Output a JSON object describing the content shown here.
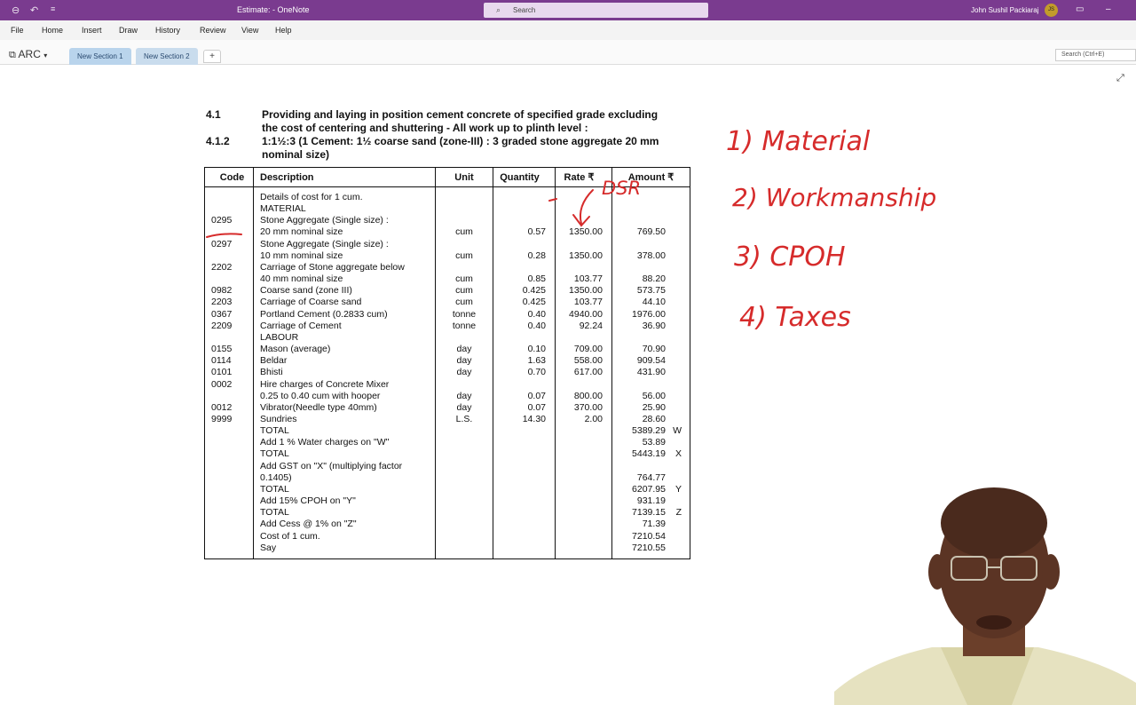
{
  "titlebar": {
    "doc_title": "Estimate:  -  OneNote",
    "search_placeholder": "Search",
    "user_name": "John Sushil Packiaraj",
    "user_initials": "JS"
  },
  "menu": {
    "file": "File",
    "home": "Home",
    "insert": "Insert",
    "draw": "Draw",
    "history": "History",
    "review": "Review",
    "view": "View",
    "help": "Help"
  },
  "notebook": {
    "name": "ARC",
    "sections": [
      "New Section 1",
      "New Section 2"
    ],
    "add_label": "+",
    "search_hint": "Search (Ctrl+E)"
  },
  "spec": {
    "num1": "4.1",
    "text1a": "Providing and laying in position cement concrete of specified grade excluding",
    "text1b": "the cost of centering and shuttering - All work up to plinth level :",
    "num2": "4.1.2",
    "text2a": "1:1½:3 (1 Cement: 1½ coarse sand (zone-III) : 3 graded stone aggregate 20 mm",
    "text2b": "nominal size)"
  },
  "table": {
    "headers": [
      "Code",
      "Description",
      "Unit",
      "Quantity",
      "Rate ₹",
      "Amount ₹"
    ],
    "rows": [
      [
        "",
        "Details of cost for 1 cum.",
        "",
        "",
        "",
        "",
        ""
      ],
      [
        "",
        "MATERIAL",
        "",
        "",
        "",
        "",
        ""
      ],
      [
        "0295",
        "Stone Aggregate (Single size) :",
        "",
        "",
        "",
        "",
        ""
      ],
      [
        "",
        "20 mm nominal size",
        "cum",
        "0.57",
        "1350.00",
        "769.50",
        ""
      ],
      [
        "0297",
        "Stone Aggregate (Single size) :",
        "",
        "",
        "",
        "",
        ""
      ],
      [
        "",
        "10 mm nominal size",
        "cum",
        "0.28",
        "1350.00",
        "378.00",
        ""
      ],
      [
        "2202",
        "Carriage of Stone aggregate below",
        "",
        "",
        "",
        "",
        ""
      ],
      [
        "",
        "40 mm nominal size",
        "cum",
        "0.85",
        "103.77",
        "88.20",
        ""
      ],
      [
        "0982",
        "Coarse sand (zone III)",
        "cum",
        "0.425",
        "1350.00",
        "573.75",
        ""
      ],
      [
        "2203",
        "Carriage of Coarse sand",
        "cum",
        "0.425",
        "103.77",
        "44.10",
        ""
      ],
      [
        "0367",
        "Portland Cement (0.2833 cum)",
        "tonne",
        "0.40",
        "4940.00",
        "1976.00",
        ""
      ],
      [
        "2209",
        "Carriage of Cement",
        "tonne",
        "0.40",
        "92.24",
        "36.90",
        ""
      ],
      [
        "",
        "LABOUR",
        "",
        "",
        "",
        "",
        ""
      ],
      [
        "0155",
        "Mason (average)",
        "day",
        "0.10",
        "709.00",
        "70.90",
        ""
      ],
      [
        "0114",
        "Beldar",
        "day",
        "1.63",
        "558.00",
        "909.54",
        ""
      ],
      [
        "0101",
        "Bhisti",
        "day",
        "0.70",
        "617.00",
        "431.90",
        ""
      ],
      [
        "0002",
        "Hire charges of Concrete Mixer",
        "",
        "",
        "",
        "",
        ""
      ],
      [
        "",
        "0.25 to 0.40 cum with hooper",
        "day",
        "0.07",
        "800.00",
        "56.00",
        ""
      ],
      [
        "0012",
        "Vibrator(Needle type 40mm)",
        "day",
        "0.07",
        "370.00",
        "25.90",
        ""
      ],
      [
        "9999",
        "Sundries",
        "L.S.",
        "14.30",
        "2.00",
        "28.60",
        ""
      ],
      [
        "",
        "TOTAL",
        "",
        "",
        "",
        "5389.29",
        "W"
      ],
      [
        "",
        "Add 1 % Water charges on \"W\"",
        "",
        "",
        "",
        "53.89",
        ""
      ],
      [
        "",
        "TOTAL",
        "",
        "",
        "",
        "5443.19",
        "X"
      ],
      [
        "",
        "Add GST on \"X\" (multiplying factor",
        "",
        "",
        "",
        "",
        ""
      ],
      [
        "",
        "0.1405)",
        "",
        "",
        "",
        "764.77",
        ""
      ],
      [
        "",
        "TOTAL",
        "",
        "",
        "",
        "6207.95",
        "Y"
      ],
      [
        "",
        "Add 15% CPOH on \"Y\"",
        "",
        "",
        "",
        "931.19",
        ""
      ],
      [
        "",
        "TOTAL",
        "",
        "",
        "",
        "7139.15",
        "Z"
      ],
      [
        "",
        "Add Cess @ 1% on \"Z\"",
        "",
        "",
        "",
        "71.39",
        ""
      ],
      [
        "",
        "Cost of 1 cum.",
        "",
        "",
        "",
        "7210.54",
        ""
      ],
      [
        "",
        "Say",
        "",
        "",
        "",
        "7210.55",
        ""
      ]
    ]
  },
  "ink_notes": {
    "item1": "1) Material",
    "item2": "2) Workmanship",
    "item3": "3) CPOH",
    "item4": "4) Taxes",
    "dsr": "DSR",
    "ink_color": "#d62b2b"
  },
  "icons": [
    "back-icon",
    "undo-icon",
    "quick-access-icon",
    "search-icon",
    "notebook-icon",
    "dropdown-icon",
    "expand-icon",
    "minimize-icon",
    "restore-icon"
  ]
}
